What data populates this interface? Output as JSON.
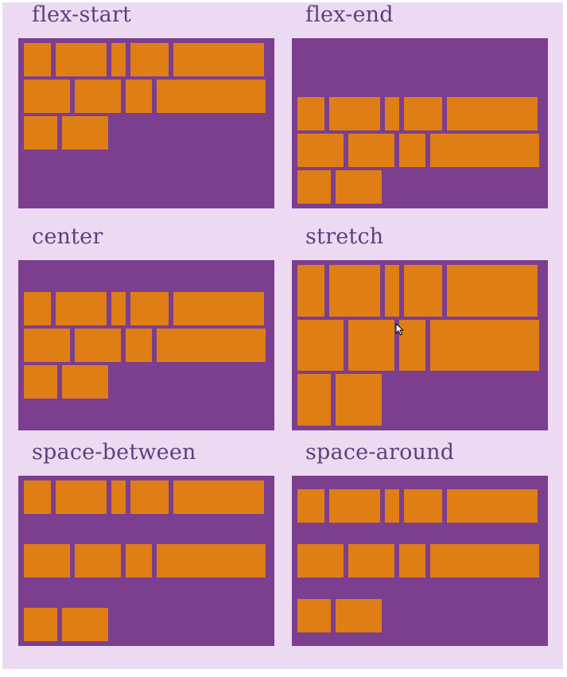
{
  "demos": [
    {
      "title": "flex-start",
      "align_content": "flex-start"
    },
    {
      "title": "flex-end",
      "align_content": "flex-end"
    },
    {
      "title": "center",
      "align_content": "center"
    },
    {
      "title": "stretch",
      "align_content": "stretch"
    },
    {
      "title": "space-between",
      "align_content": "space-between"
    },
    {
      "title": "space-around",
      "align_content": "space-around"
    }
  ],
  "colors": {
    "page_background": "#ecdaf2",
    "container": "#7c3e8e",
    "item": "#e07e16",
    "title_text": "#5f3f7e"
  },
  "icons": {
    "cursor": "mouse-pointer-icon"
  }
}
